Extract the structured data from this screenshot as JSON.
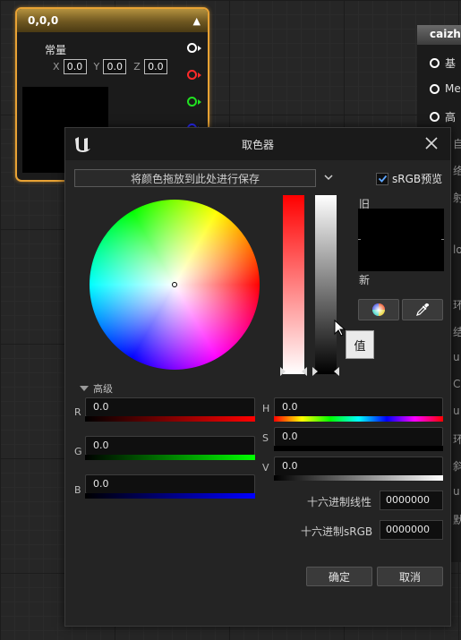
{
  "node": {
    "title": "0,0,0",
    "collapse_icon": "chevron-up-icon",
    "row_label": "常量",
    "x_label": "X",
    "x_value": "0.0",
    "y_label": "Y",
    "y_value": "0.0",
    "z_label": "Z",
    "z_value": "0.0",
    "pin_colors": [
      "#ffffff",
      "#ff2a2a",
      "#21e121",
      "#2a2aff"
    ]
  },
  "node2": {
    "title": "caizhi",
    "rows": [
      "基",
      "Me",
      "高"
    ],
    "side_texts": [
      "自",
      "络",
      "射",
      "lo",
      "环",
      "结",
      "u",
      "Cu",
      "u",
      "环",
      "斜",
      "u",
      "默"
    ]
  },
  "dialog": {
    "title": "取色器",
    "save_drop_label": "将颜色拖放到此处进行保存",
    "srgb_label": "sRGB预览",
    "srgb_checked": true,
    "old_label": "旧",
    "new_label": "新",
    "old_color": "#000000",
    "new_color": "#000000",
    "tooltip": "值",
    "advanced_label": "高级",
    "channels": {
      "r": {
        "label": "R",
        "value": "0.0"
      },
      "g": {
        "label": "G",
        "value": "0.0"
      },
      "b": {
        "label": "B",
        "value": "0.0"
      },
      "h": {
        "label": "H",
        "value": "0.0"
      },
      "s": {
        "label": "S",
        "value": "0.0"
      },
      "v": {
        "label": "V",
        "value": "0.0"
      }
    },
    "hex_linear_label": "十六进制线性",
    "hex_linear_value": "0000000",
    "hex_srgb_label": "十六进制sRGB",
    "hex_srgb_value": "0000000",
    "ok_label": "确定",
    "cancel_label": "取消"
  }
}
